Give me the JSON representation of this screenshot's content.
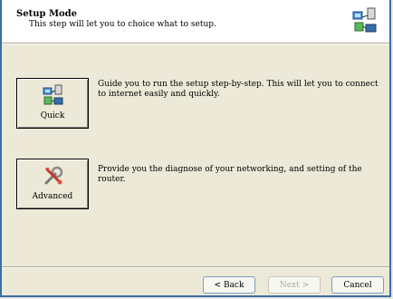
{
  "header": {
    "title": "Setup Mode",
    "subtitle": "This step will let you to choice what to setup."
  },
  "options": [
    {
      "label": "Quick",
      "description": "Guide you to run the setup step-by-step. This will let you to connect to internet easily and quickly.",
      "icon": "network-computer-icon"
    },
    {
      "label": "Advanced",
      "description": "Provide you the diagnose of your networking, and setting of the router.",
      "icon": "tools-icon"
    }
  ],
  "footer": {
    "back_label": "< Back",
    "next_label": "Next >",
    "cancel_label": "Cancel"
  }
}
